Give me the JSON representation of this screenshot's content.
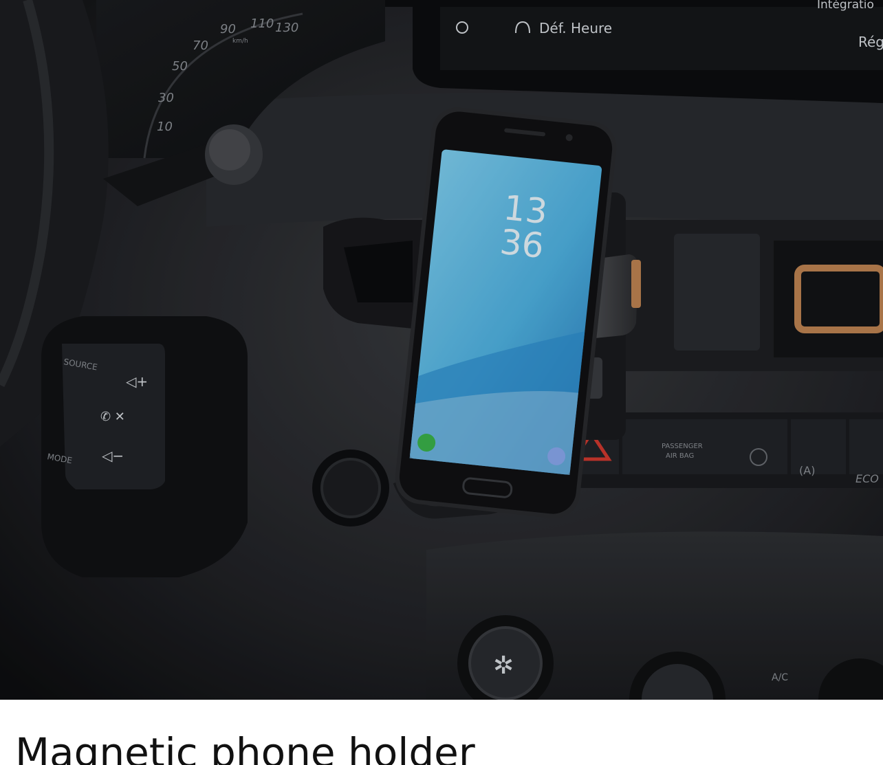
{
  "product": {
    "title": "Magnetic phone holder"
  },
  "photo": {
    "infotainment": {
      "menu_item": "Déf. Heure",
      "top_right_text": "Intégratio",
      "right_text": "Rég"
    },
    "phone": {
      "clock_hour": "13",
      "clock_minute": "36"
    },
    "steering_controls": {
      "left_top": "SOURCE",
      "left_bottom": "MODE"
    },
    "dashboard": {
      "airbag_label_line1": "PASSENGER",
      "airbag_label_line2": "AIR BAG",
      "eco_label": "ECO",
      "ac_label": "A/C",
      "auto_stop_label": "(A)"
    },
    "speedometer_ticks": [
      "130",
      "110",
      "90",
      "70",
      "50",
      "30",
      "10"
    ],
    "speed_unit": "km/h"
  },
  "colors": {
    "phone_screen": "#4fb3e3",
    "vent_accent": "#c08552",
    "hazard_red": "#d23a2f",
    "call_green": "#3bb34a"
  }
}
